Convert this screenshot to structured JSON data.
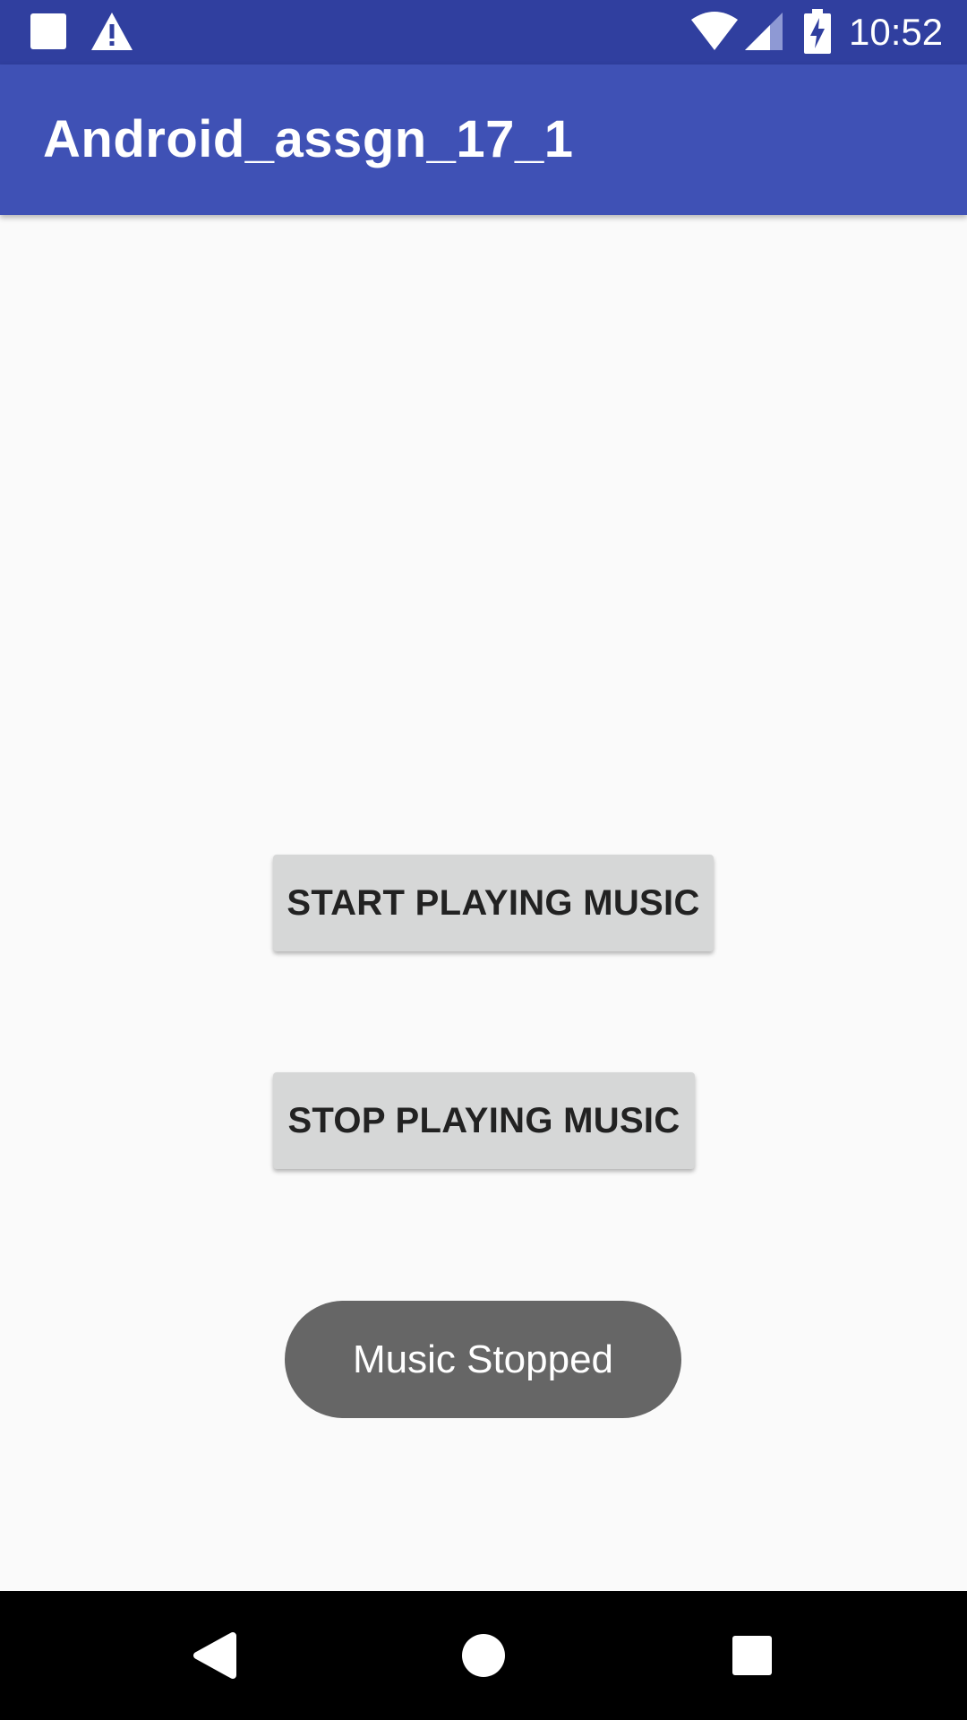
{
  "status_bar": {
    "time": "10:52",
    "icons": [
      "notification-square-icon",
      "warning-icon",
      "wifi-icon",
      "cell-signal-icon",
      "battery-charging-icon"
    ]
  },
  "app_bar": {
    "title": "Android_assgn_17_1"
  },
  "main": {
    "start_button_label": "START PLAYING MUSIC",
    "stop_button_label": "STOP PLAYING MUSIC"
  },
  "toast": {
    "message": "Music Stopped"
  },
  "nav_bar": {
    "icons": [
      "back-icon",
      "home-icon",
      "recents-icon"
    ]
  },
  "colors": {
    "status_bar": "#303f9f",
    "app_bar": "#3f51b5",
    "background": "#fafafa",
    "button": "#d6d7d7",
    "toast": "#666666",
    "nav_bar": "#000000"
  }
}
